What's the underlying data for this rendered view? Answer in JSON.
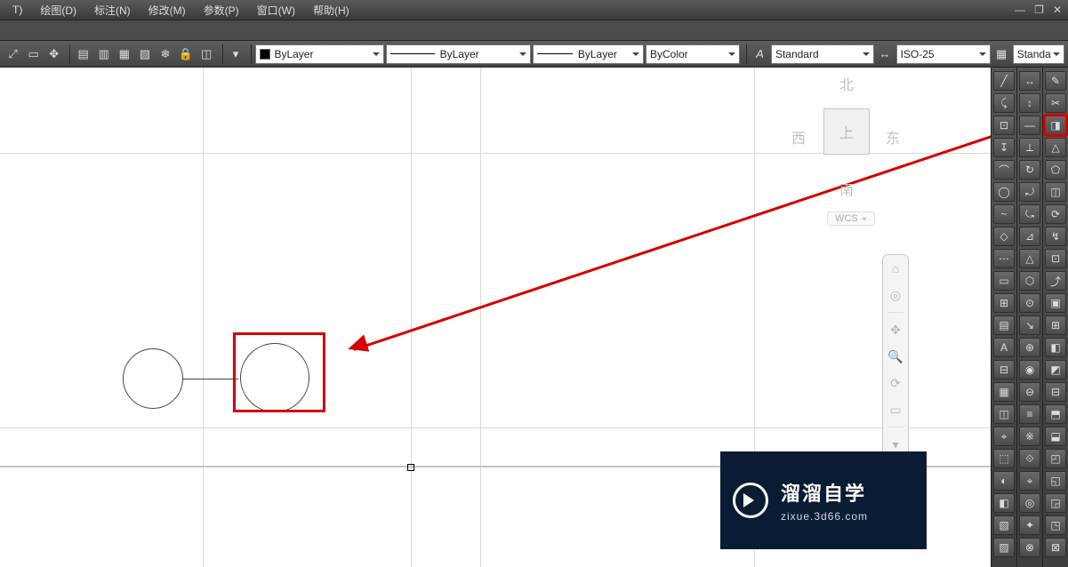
{
  "menus": {
    "t": "T)",
    "draw": "绘图(D)",
    "annotate": "标注(N)",
    "modify": "修改(M)",
    "param": "参数(P)",
    "window": "窗口(W)",
    "help": "帮助(H)"
  },
  "window_controls": {
    "minimize": "—",
    "maximize": "❐",
    "close": "✕"
  },
  "toolbar_icons": {
    "zoom_window": "⤢",
    "zoom_extents": "▭",
    "pan": "✥",
    "layer_props": "▤",
    "layer_states": "▥",
    "layer_iso": "▦",
    "layer_off": "▧",
    "layer_freeze": "❄",
    "layer_lock": "🔒",
    "layer_match": "◫"
  },
  "properties": {
    "color_label": "ByLayer",
    "linetype_label": "ByLayer",
    "lineweight_label": "ByLayer",
    "plotstyle_label": "ByColor",
    "textstyle_label": "Standard",
    "dimstyle_label": "ISO-25",
    "tablestyle_label": "Standa"
  },
  "viewcube": {
    "north": "北",
    "south": "南",
    "east": "东",
    "west": "西",
    "top": "上",
    "wcs": "WCS"
  },
  "navbar": {
    "home": "⌂",
    "wheel": "◎",
    "pan": "✥",
    "zoom": "🔍",
    "orbit": "⟳",
    "show": "▭",
    "settings": "▾"
  },
  "palette1": [
    "╱",
    "⤹",
    "⊡",
    "↧",
    "⌒",
    "◯",
    "~",
    "◇",
    "⋯",
    "▭",
    "⊞",
    "▤",
    "A",
    "⊟",
    "▦",
    "◫",
    "⌖",
    "⬚",
    "◐",
    "◧",
    "▧",
    "▨"
  ],
  "palette2": [
    "↔",
    "↕",
    "—",
    "⟂",
    "↻",
    "⤾",
    "⤿",
    "⊿",
    "△",
    "⬡",
    "⊙",
    "↘",
    "⊕",
    "◉",
    "⊖",
    "≡",
    "※",
    "⟐",
    "⌖",
    "◎",
    "✦",
    "⊗"
  ],
  "palette3": [
    "✎",
    "✂",
    "◨",
    "△",
    "⬠",
    "◫",
    "⟳",
    "↯",
    "⊡",
    "⤴",
    "▣",
    "⊞",
    "◧",
    "◩",
    "⊟",
    "⬒",
    "⬓",
    "◰",
    "◱",
    "◲",
    "◳",
    "⊠"
  ],
  "watermark": {
    "title": "溜溜自学",
    "url": "zixue.3d66.com"
  }
}
